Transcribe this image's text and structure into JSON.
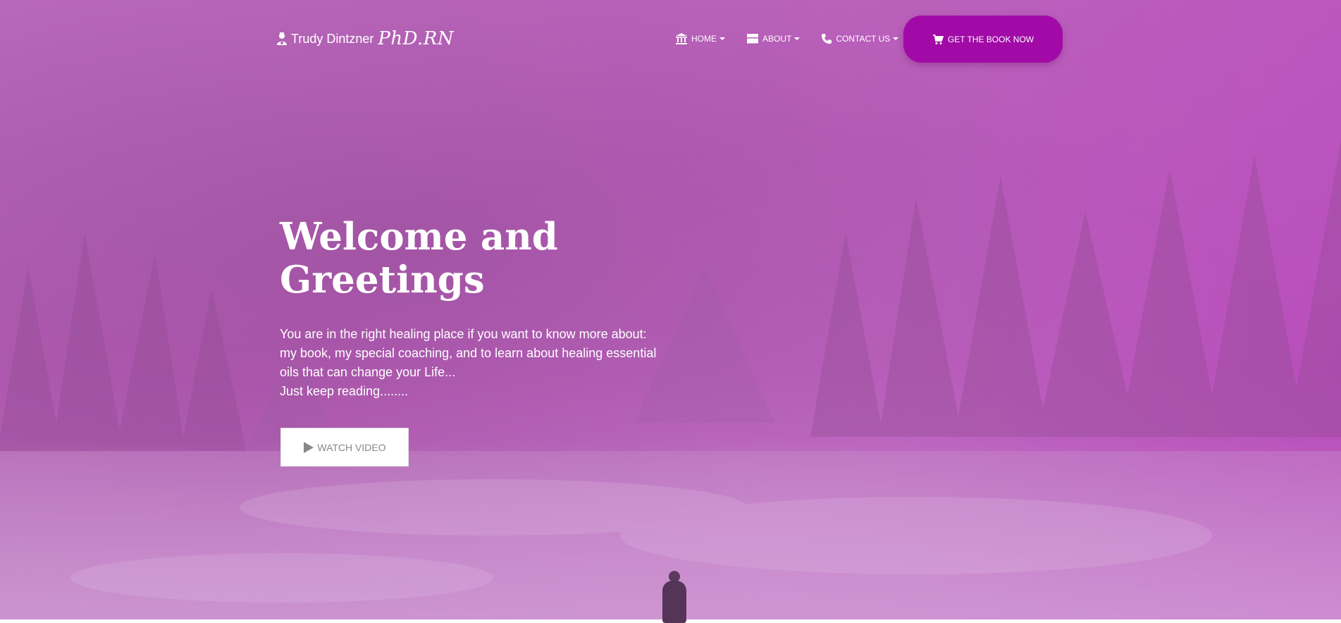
{
  "brand": {
    "name": "Trudy Dintzner",
    "title": "PhD.RN",
    "icon": "user-nurse-icon"
  },
  "nav": {
    "items": [
      {
        "label": "HOME",
        "icon": "bank-icon"
      },
      {
        "label": "ABOUT",
        "icon": "layout-icon"
      },
      {
        "label": "CONTACT US",
        "icon": "phone-icon"
      }
    ],
    "cta": {
      "label": "GET THE BOOK NOW",
      "icon": "cart-icon"
    }
  },
  "hero": {
    "title_line1": "Welcome and",
    "title_line2": "Greetings",
    "body_lines": [
      "You are in the right healing place if you want to know more about:",
      "my book, my special coaching, and to learn about healing essential",
      "oils that can change your Life...",
      "Just keep reading........"
    ],
    "watch_video_label": "WATCH VIDEO"
  },
  "colors": {
    "accent": "#a10aa6",
    "overlay": "#b868b9"
  }
}
